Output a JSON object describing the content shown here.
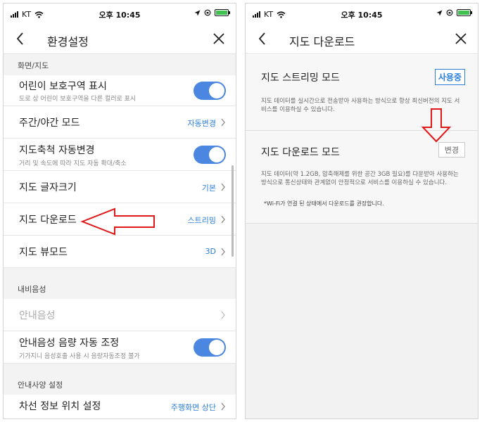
{
  "status_bar": {
    "carrier": "KT",
    "time": "오후 10:45"
  },
  "left": {
    "title": "환경설정",
    "sections": [
      {
        "header": "화면/지도"
      },
      {
        "header": "내비음성"
      },
      {
        "header": "안내사양 설정"
      }
    ],
    "rows": {
      "child_zone": {
        "label": "어린이 보호구역 표시",
        "sub": "도로 상 어린이 보호구역을 다른 컬러로 표시"
      },
      "day_night": {
        "label": "주간/야간 모드",
        "value": "자동변경"
      },
      "auto_scale": {
        "label": "지도축척 자동변경",
        "sub": "거리 및 속도에 따라 지도 자동 확대/축소"
      },
      "font_size": {
        "label": "지도 글자크기",
        "value": "기본"
      },
      "map_download": {
        "label": "지도 다운로드",
        "value": "스트리밍"
      },
      "view_mode": {
        "label": "지도 뷰모드",
        "value": "3D"
      },
      "guide_voice": {
        "label": "안내음성"
      },
      "voice_volume": {
        "label": "안내음성 음량 자동 조정",
        "sub": "기가지니 음성호출 사용 시 음량자동조정 불가"
      },
      "lane_info": {
        "label": "차선 정보 위치 설정",
        "value": "주행화면 상단"
      }
    }
  },
  "right": {
    "title": "지도 다운로드",
    "streaming": {
      "title": "지도 스트리밍 모드",
      "button": "사용중",
      "desc": "지도 데이터를 실시간으로 전송받아 사용하는 방식으로 항상 최신버전의 지도 서비스를 이용하실 수 있습니다."
    },
    "download": {
      "title": "지도 다운로드 모드",
      "button": "변경",
      "desc": "지도 데이터(약 1.2GB, 압축해제를 위한 공간 3GB 필요)를 다운받아 사용하는 방식으로 통신상태와 관계없이 안정적으로 서비스를 이용하실 수 있습니다.",
      "note": "*Wi-Fi가 연결 된 상태에서 다운로드를 권장합니다."
    }
  },
  "colors": {
    "accent": "#2b7fd9",
    "toggle": "#4b87e0",
    "arrow": "#e01818"
  },
  "icons": [
    "signal-icon",
    "wifi-icon",
    "location-icon",
    "battery-icon",
    "back-arrow-icon",
    "close-icon",
    "chevron-right-icon",
    "red-arrow-annotation"
  ]
}
